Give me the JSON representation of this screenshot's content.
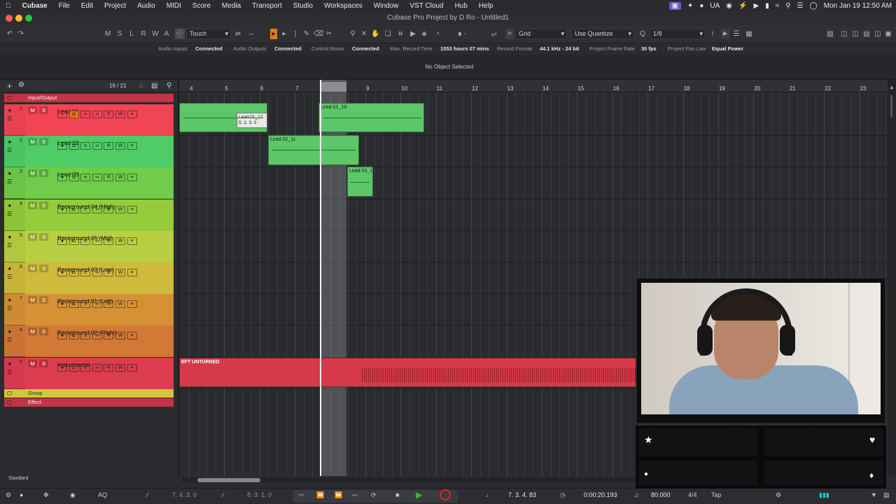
{
  "menubar": {
    "apple_icon": "apple-icon",
    "items": [
      "Cubase",
      "File",
      "Edit",
      "Project",
      "Audio",
      "MIDI",
      "Score",
      "Media",
      "Transport",
      "Studio",
      "Workspaces",
      "Window",
      "VST Cloud",
      "Hub",
      "Help"
    ],
    "input_source": "UA",
    "datetime": "Mon Jan 19  12:50 AM"
  },
  "window": {
    "title": "Cubase Pro Project by D Ro - Untitled1"
  },
  "toolbar": {
    "mode_buttons": [
      "M",
      "S",
      "L",
      "R",
      "W",
      "A"
    ],
    "automation_mode": "Touch",
    "snap_type": "Grid",
    "quantize_type": "Use Quantize",
    "quantize_value": "1/8"
  },
  "status": {
    "audio_inputs_label": "Audio Inputs",
    "audio_inputs_value": "Connected",
    "audio_outputs_label": "Audio Outputs",
    "audio_outputs_value": "Connected",
    "control_room_label": "Control Room",
    "control_room_value": "Connected",
    "max_record_label": "Max. Record Time",
    "max_record_value": "1553 hours 07 mins",
    "record_format_label": "Record Format",
    "record_format_value": "44.1 kHz - 24 bit",
    "frame_rate_label": "Project Frame Rate",
    "frame_rate_value": "30 fps",
    "pan_law_label": "Project Pan Law",
    "pan_law_value": "Equal Power"
  },
  "infoline": {
    "text": "No Object Selected"
  },
  "tracklist": {
    "track_count": "16 / 21",
    "io_folder": "Input/Output",
    "tracks": [
      {
        "num": "1",
        "name": "Lead 01",
        "color": "#e84152",
        "armed": true
      },
      {
        "num": "2",
        "name": "Lead 02",
        "color": "#4cc462"
      },
      {
        "num": "3",
        "name": "Lead 03",
        "color": "#6cc447"
      },
      {
        "num": "4",
        "name": "Background 04 (High)",
        "color": "#8fc43a"
      },
      {
        "num": "5",
        "name": "Background 05 (Mid)",
        "color": "#b2c640"
      },
      {
        "num": "6",
        "name": "Background 03 (Low)",
        "color": "#c7b33a"
      },
      {
        "num": "7",
        "name": "Background 01 (Left)",
        "color": "#cf8b33"
      },
      {
        "num": "8",
        "name": "Background 02 (Right)",
        "color": "#c97433"
      },
      {
        "num": "9",
        "name": "Instrumental",
        "color": "#d33b4c"
      }
    ],
    "group_folder": "Group",
    "effect_folder": "Effect",
    "preset": "Standard"
  },
  "arrange": {
    "ruler_ticks": [
      "4",
      "5",
      "6",
      "7",
      "8",
      "9",
      "10",
      "11",
      "12",
      "13",
      "14",
      "15",
      "16",
      "17",
      "18",
      "19",
      "20",
      "21",
      "22",
      "23"
    ],
    "events": [
      {
        "label": "Lead 01_17",
        "tooltip_time": "5. 1. 3.   0"
      },
      {
        "label": "Lead 01_19"
      },
      {
        "label": "Lead 02_11"
      },
      {
        "label": "Lead 03_1"
      },
      {
        "label": "EFT UNTURNED"
      }
    ]
  },
  "transport": {
    "left_locator": "7. 4. 3.    0",
    "right_locator": "8. 3. 1.    0",
    "position": "7. 3. 4.  83",
    "time": "0:00:20.193",
    "tempo": "80.000",
    "signature": "4/4",
    "tap_label": "Tap",
    "aq_label": "AQ"
  },
  "colors": {
    "event_green": "#5dc66a",
    "event_red": "#d63a48",
    "record_red": "#e8202a",
    "play_green": "#2fbf3a"
  }
}
